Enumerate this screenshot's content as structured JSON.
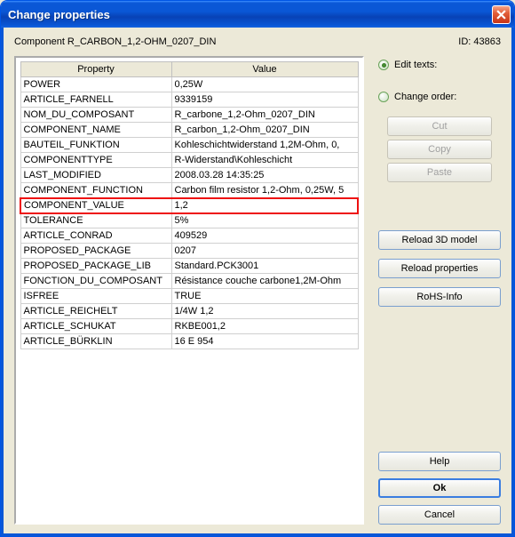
{
  "window": {
    "title": "Change properties"
  },
  "header": {
    "component_label": "Component R_CARBON_1,2-OHM_0207_DIN",
    "id_label": "ID: 43863"
  },
  "table": {
    "col_property": "Property",
    "col_value": "Value",
    "rows": [
      {
        "p": "POWER",
        "v": "0,25W",
        "hl": false
      },
      {
        "p": "ARTICLE_FARNELL",
        "v": "9339159",
        "hl": false
      },
      {
        "p": "NOM_DU_COMPOSANT",
        "v": "R_carbone_1,2-Ohm_0207_DIN",
        "hl": false
      },
      {
        "p": "COMPONENT_NAME",
        "v": "R_carbon_1,2-Ohm_0207_DIN",
        "hl": false
      },
      {
        "p": "BAUTEIL_FUNKTION",
        "v": "Kohleschichtwiderstand 1,2M-Ohm, 0,",
        "hl": false
      },
      {
        "p": "COMPONENTTYPE",
        "v": "R-Widerstand\\Kohleschicht",
        "hl": false
      },
      {
        "p": "LAST_MODIFIED",
        "v": "2008.03.28 14:35:25",
        "hl": false
      },
      {
        "p": "COMPONENT_FUNCTION",
        "v": "Carbon film resistor 1,2-Ohm, 0,25W, 5",
        "hl": false
      },
      {
        "p": "COMPONENT_VALUE",
        "v": "1,2",
        "hl": true
      },
      {
        "p": "TOLERANCE",
        "v": "5%",
        "hl": false
      },
      {
        "p": "ARTICLE_CONRAD",
        "v": "409529",
        "hl": false
      },
      {
        "p": "PROPOSED_PACKAGE",
        "v": "0207",
        "hl": false
      },
      {
        "p": "PROPOSED_PACKAGE_LIB",
        "v": "Standard.PCK3001",
        "hl": false
      },
      {
        "p": "FONCTION_DU_COMPOSANT",
        "v": "Résistance couche carbone1,2M-Ohm",
        "hl": false
      },
      {
        "p": "ISFREE",
        "v": "TRUE",
        "hl": false
      },
      {
        "p": "ARTICLE_REICHELT",
        "v": "1/4W 1,2",
        "hl": false
      },
      {
        "p": "ARTICLE_SCHUKAT",
        "v": "RKBE001,2",
        "hl": false
      },
      {
        "p": "ARTICLE_BÜRKLIN",
        "v": "16 E 954",
        "hl": false
      }
    ]
  },
  "side": {
    "edit_texts_label": "Edit texts:",
    "change_order_label": "Change order:",
    "cut": "Cut",
    "copy": "Copy",
    "paste": "Paste",
    "reload3d": "Reload 3D model",
    "reloadprops": "Reload properties",
    "rohs": "RoHS-Info",
    "help": "Help",
    "ok": "Ok",
    "cancel": "Cancel"
  }
}
